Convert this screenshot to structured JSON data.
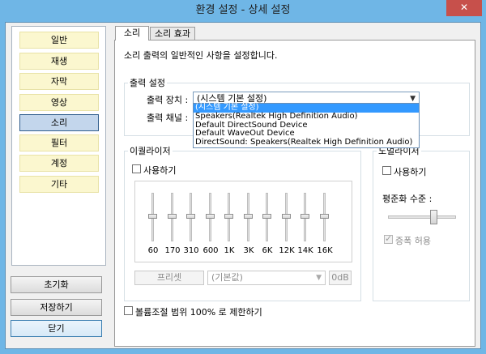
{
  "window": {
    "title": "환경 설정 - 상세 설정",
    "close_glyph": "✕"
  },
  "sidebar": {
    "categories": [
      "일반",
      "재생",
      "자막",
      "영상",
      "소리",
      "필터",
      "계정",
      "기타"
    ],
    "active": "소리",
    "buttons": {
      "reset": "초기화",
      "save": "저장하기",
      "close": "닫기"
    }
  },
  "tabs": [
    {
      "label": "소리",
      "active": true
    },
    {
      "label": "소리 효과",
      "active": false
    }
  ],
  "panel": {
    "description": "소리 출력의 일반적인 사항을 설정합니다.",
    "output": {
      "group_label": "출력 설정",
      "device_label": "출력 장치 :",
      "device_value": "(시스템 기본 설정)",
      "channel_label": "출력 채널 :",
      "device_options": [
        "(시스템 기본 설정)",
        "Speakers(Realtek High Definition Audio)",
        "Default DirectSound Device",
        "Default WaveOut Device",
        "DirectSound: Speakers(Realtek High Definition Audio)"
      ]
    },
    "equalizer": {
      "group_label": "이퀄라이저",
      "enable_label": "사용하기",
      "bands": [
        "60",
        "170",
        "310",
        "600",
        "1K",
        "3K",
        "6K",
        "12K",
        "14K",
        "16K"
      ],
      "preset_button": "프리셋",
      "preset_value": "(기본값)",
      "gain_value": "0dB"
    },
    "normalizer": {
      "group_label": "노멀라이저",
      "enable_label": "사용하기",
      "level_label": "평준화 수준 :",
      "amplify_label": "증폭 허용",
      "amplify_checked": true
    },
    "volume_limit_label": "볼륨조절 범위 100% 로 제한하기"
  },
  "colors": {
    "accent": "#6fb6e6",
    "close": "#c7504b",
    "category_bg": "#fbf7cf",
    "selection": "#3399ff"
  }
}
